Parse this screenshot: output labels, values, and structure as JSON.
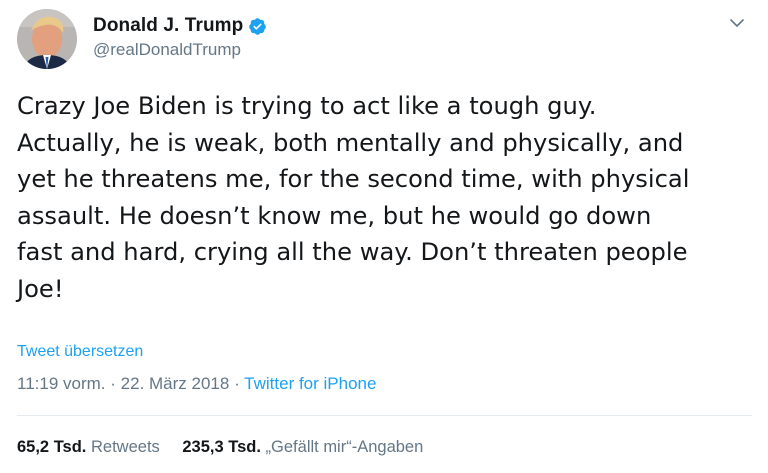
{
  "user": {
    "display_name": "Donald J. Trump",
    "handle": "@realDonaldTrump",
    "verified_icon": "verified-badge-icon"
  },
  "tweet": {
    "text": "Crazy Joe Biden is trying to act like a tough guy.\nActually, he is weak, both mentally and physically, and\nyet he threatens me, for the second time, with physical\nassault. He doesn’t know me, but he would go down\nfast and hard, crying all the way. Don’t threaten people\nJoe!",
    "translate_label": "Tweet übersetzen",
    "time": "11:19 vorm.",
    "separator": "·",
    "date": "22. März 2018",
    "source": "Twitter for iPhone"
  },
  "stats": {
    "retweets_count": "65,2 Tsd.",
    "retweets_label": "Retweets",
    "likes_count": "235,3 Tsd.",
    "likes_label": "„Gefällt mir“-Angaben"
  },
  "colors": {
    "link": "#1da1f2",
    "muted": "#657786",
    "text": "#14171a"
  }
}
